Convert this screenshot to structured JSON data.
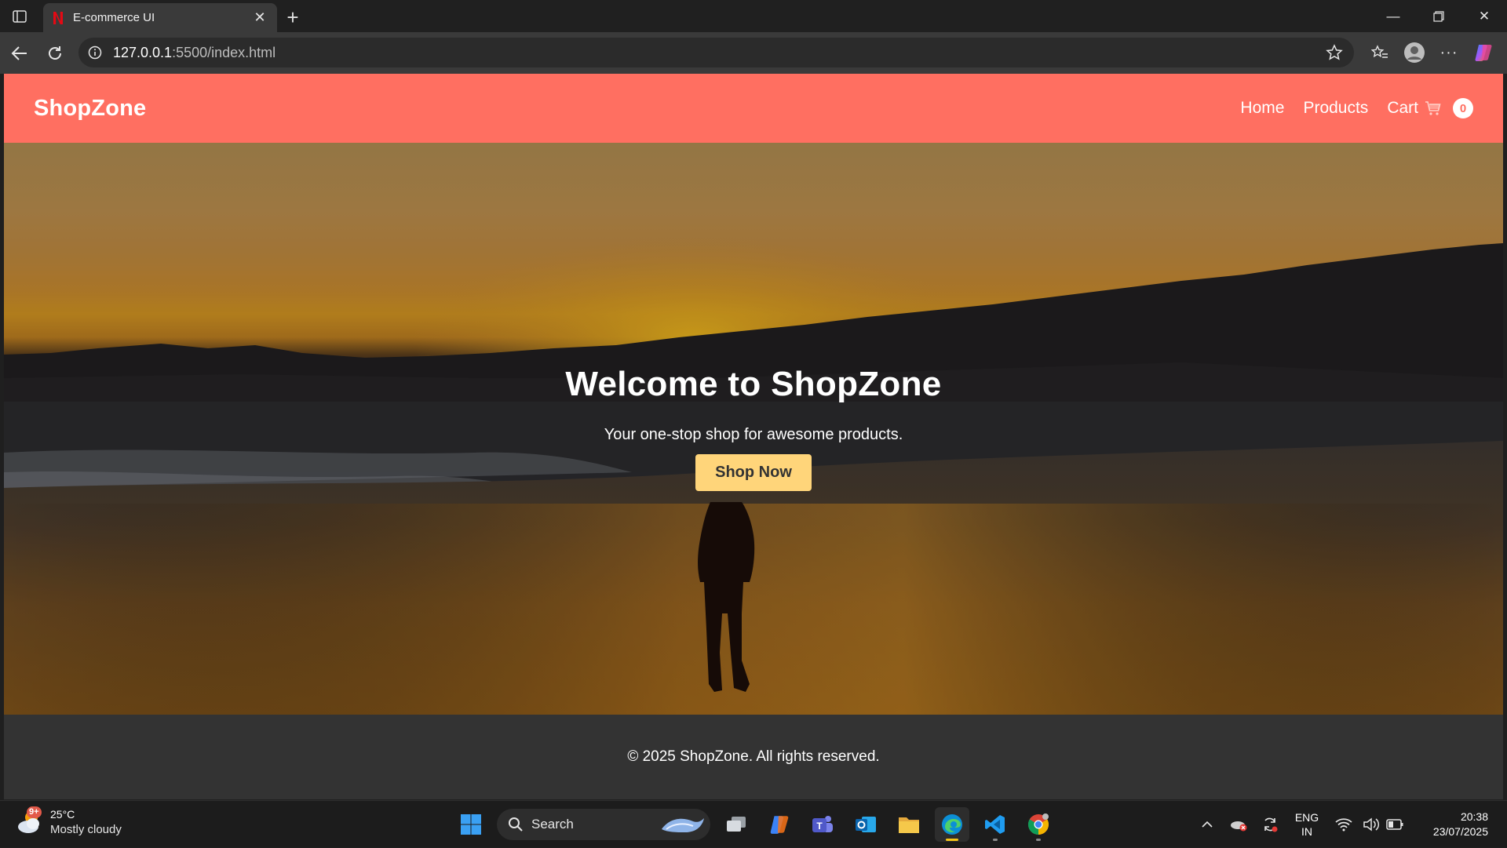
{
  "browser": {
    "tab_title": "E-commerce UI",
    "url_host": "127.0.0.1",
    "url_rest": ":5500/index.html"
  },
  "navbar": {
    "brand": "ShopZone",
    "links": [
      "Home",
      "Products",
      "Cart"
    ],
    "cart_icon": "cart-icon",
    "cart_count": "0",
    "color": "#ff6f61"
  },
  "hero": {
    "title": "Welcome to ShopZone",
    "subtitle": "Your one-stop shop for awesome products.",
    "button_label": "Shop Now",
    "button_color": "#ffd57a"
  },
  "footer": {
    "text": "© 2025 ShopZone. All rights reserved."
  },
  "taskbar": {
    "weather_badge": "9+",
    "temperature": "25°C",
    "condition": "Mostly cloudy",
    "search_label": "Search",
    "language_top": "ENG",
    "language_bottom": "IN",
    "time": "20:38",
    "date": "23/07/2025"
  }
}
